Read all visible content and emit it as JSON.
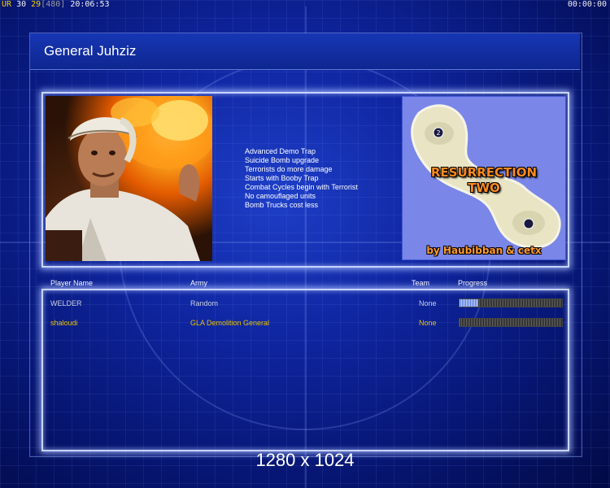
{
  "status_bar": {
    "tag": "UR",
    "n1": "30",
    "n2": "29",
    "bracket_value": "[480]",
    "clock": "20:06:53",
    "timer": "00:00:00"
  },
  "title": "General Juhziz",
  "general_features": [
    "Advanced Demo Trap",
    "Suicide Bomb upgrade",
    "Terrorists do more damage",
    "Starts with Booby Trap",
    "Combat Cycles begin with Terrorist",
    "No camouflaged units",
    "Bomb Trucks cost less"
  ],
  "map": {
    "title_line1": "RESURRECTION",
    "title_line2": "TWO",
    "credit": "by Haubibban & cetx",
    "player_marker_label": "2",
    "colors": {
      "water": "#7a86e8",
      "land": "#e8e4c4",
      "title_text": "#ff8a1e"
    }
  },
  "table": {
    "headers": {
      "player": "Player Name",
      "army": "Army",
      "team": "Team",
      "progress": "Progress"
    },
    "rows": [
      {
        "name": "WELDER",
        "army": "Random",
        "team": "None",
        "progress": 0.18
      },
      {
        "name": "shaloudi",
        "army": "GLA Demolition General",
        "team": "None",
        "progress": 0.0
      }
    ]
  },
  "resolution_caption": "1280 x 1024",
  "colors": {
    "background": "#0f25a0",
    "frame_glow": "#c8d4ff",
    "player2_text": "#e6c200",
    "status_yellow": "#f0d200"
  }
}
